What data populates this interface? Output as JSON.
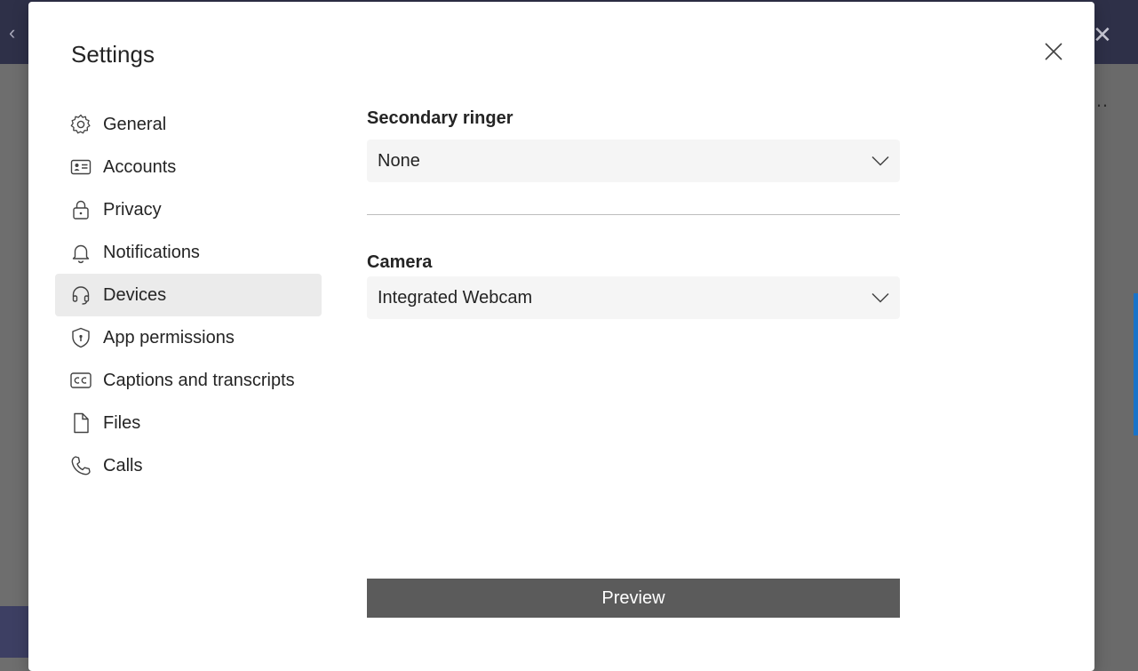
{
  "dialog": {
    "title": "Settings"
  },
  "nav": {
    "items": [
      {
        "label": "General",
        "icon": "gear-icon"
      },
      {
        "label": "Accounts",
        "icon": "id-card-icon"
      },
      {
        "label": "Privacy",
        "icon": "lock-icon"
      },
      {
        "label": "Notifications",
        "icon": "bell-icon"
      },
      {
        "label": "Devices",
        "icon": "headset-icon",
        "active": true
      },
      {
        "label": "App permissions",
        "icon": "shield-icon"
      },
      {
        "label": "Captions and transcripts",
        "icon": "closed-captions-icon"
      },
      {
        "label": "Files",
        "icon": "file-icon"
      },
      {
        "label": "Calls",
        "icon": "phone-icon"
      }
    ]
  },
  "devices": {
    "secondary_ringer": {
      "label": "Secondary ringer",
      "value": "None"
    },
    "camera": {
      "label": "Camera",
      "value": "Integrated Webcam"
    },
    "preview_label": "Preview"
  },
  "colors": {
    "active_nav_bg": "#ebebeb",
    "select_bg": "#f5f5f5",
    "preview_bg": "#5b5b5b",
    "topbar": "#2e3048"
  }
}
